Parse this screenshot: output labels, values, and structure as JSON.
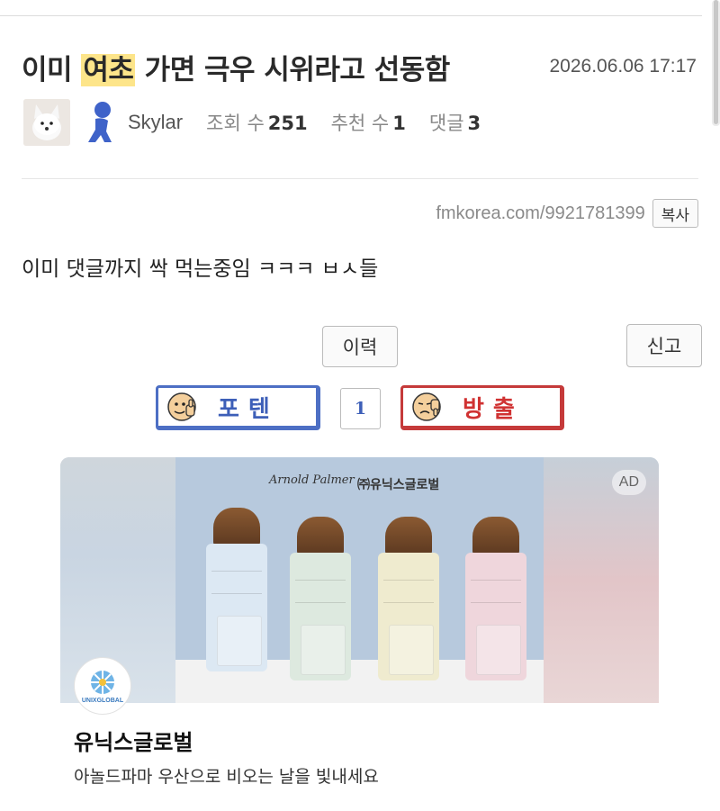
{
  "post": {
    "title_before": "이미 ",
    "title_highlight": "여초",
    "title_after": " 가면 극우 시위라고 선동함",
    "date": "2026.06.06 17:17",
    "author": "Skylar",
    "views_label": "조회 수",
    "views": "251",
    "recommend_label": "추천 수",
    "recommend": "1",
    "comments_label": "댓글",
    "comments": "3",
    "url": "fmkorea.com/9921781399",
    "copy_label": "복사",
    "content": "이미 댓글까지 싹 먹는중임 ㅋㅋㅋ ㅂㅅ들"
  },
  "actions": {
    "history_label": "이력",
    "report_label": "신고",
    "upvote_label": "포텐",
    "vote_count": "1",
    "downvote_label": "방출"
  },
  "ad": {
    "badge": "AD",
    "brand_header": "㈜유닉스글로벌",
    "signature": "Arnold Palmer",
    "logo_text": "UNIXGLOBAL",
    "title": "유닉스글로벌",
    "description": "아놀드파마 우산으로 비오는 날을 빛내세요"
  },
  "colors": {
    "highlight": "#fde58a",
    "upvote": "#4d6fc4",
    "downvote": "#c53a3a",
    "umbrellas": [
      "#dce8f3",
      "#dde9df",
      "#efebcf",
      "#efd6dc"
    ]
  },
  "icons": {
    "avatar": "arctic-fox-avatar-icon",
    "level": "blue-person-level-icon",
    "upvote_face": "thumbs-up-face-icon",
    "downvote_face": "thumbs-down-face-icon"
  }
}
